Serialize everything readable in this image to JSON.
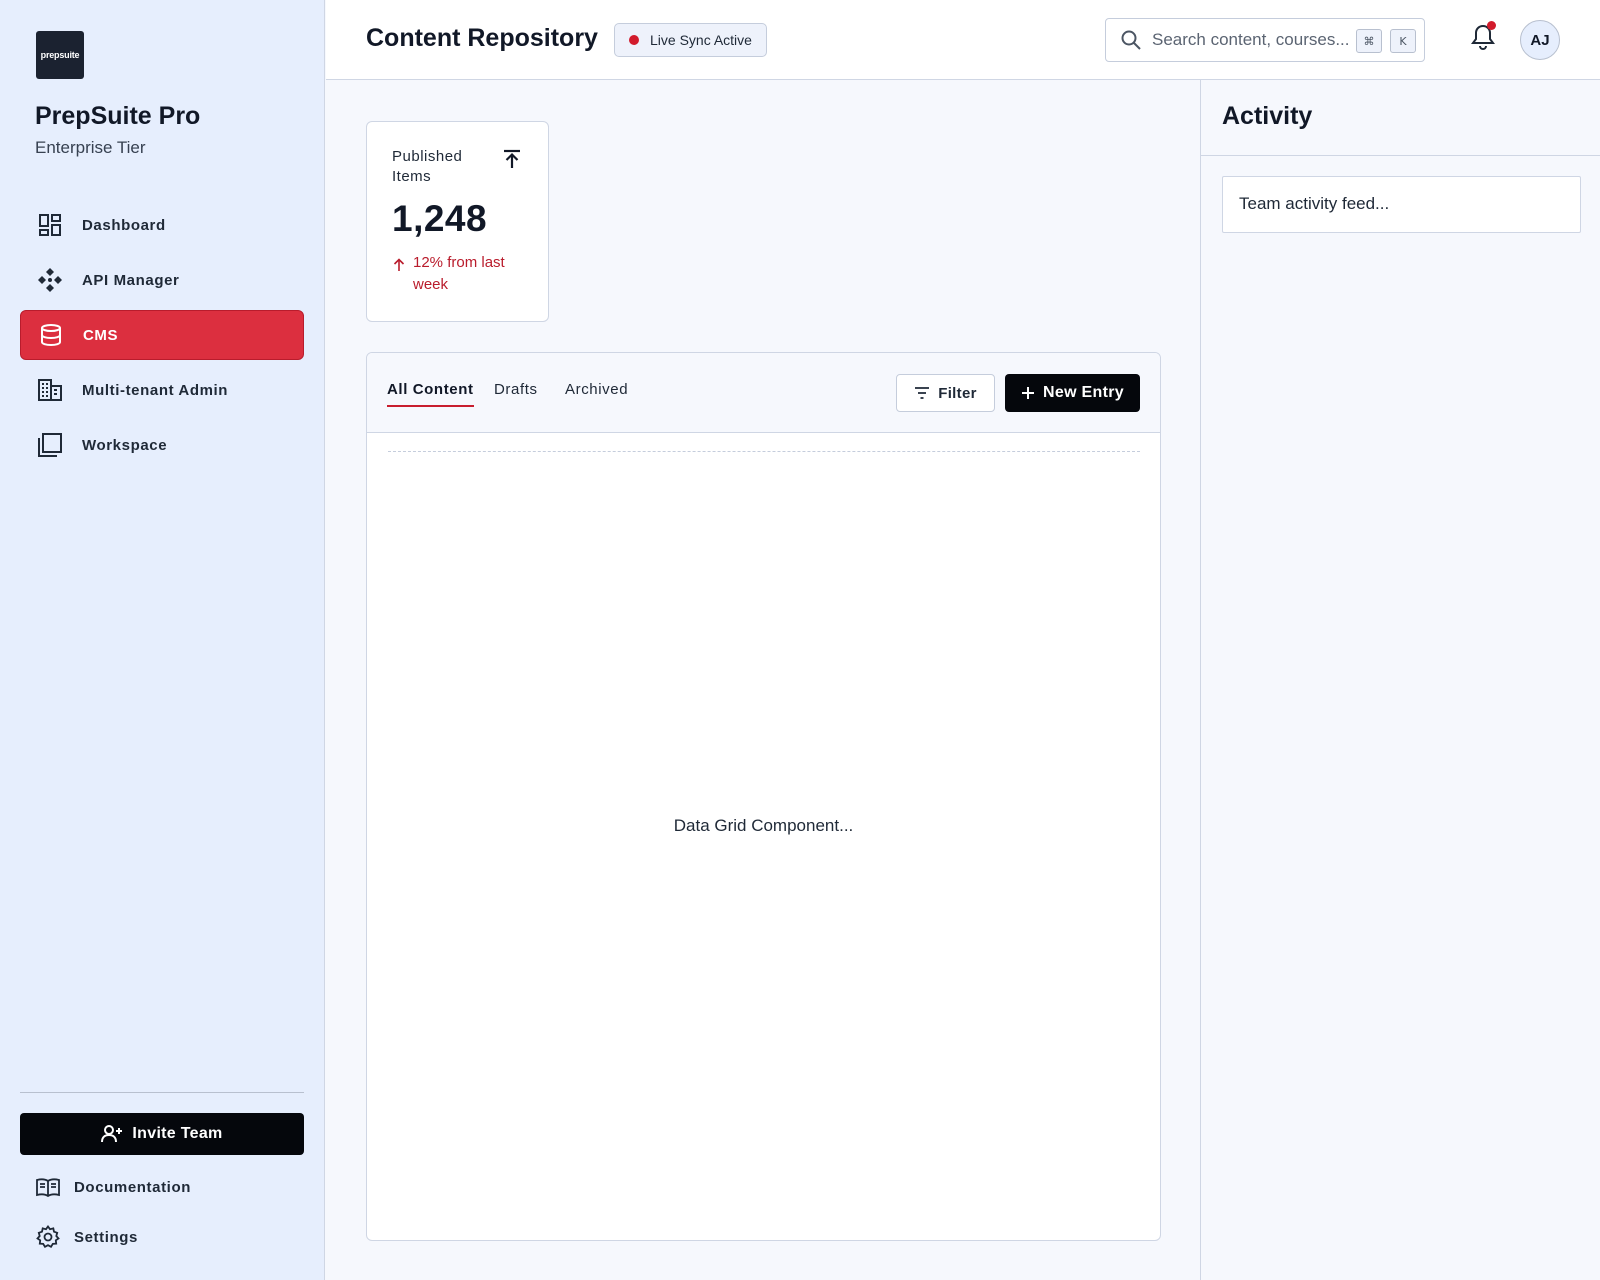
{
  "sidebar": {
    "logo_text": "prepsuite",
    "brand_name": "PrepSuite Pro",
    "brand_tier": "Enterprise Tier",
    "items": [
      {
        "label": "Dashboard",
        "icon": "dashboard-icon"
      },
      {
        "label": "API Manager",
        "icon": "api-icon"
      },
      {
        "label": "CMS",
        "icon": "database-icon",
        "active": true
      },
      {
        "label": "Multi-tenant Admin",
        "icon": "building-icon"
      },
      {
        "label": "Workspace",
        "icon": "workspace-icon"
      }
    ],
    "invite_label": "Invite Team",
    "documentation_label": "Documentation",
    "settings_label": "Settings"
  },
  "header": {
    "title": "Content Repository",
    "sync_label": "Live Sync Active",
    "search_placeholder": "Search content, courses...",
    "kbd_cmd": "⌘",
    "kbd_k": "K",
    "avatar_initials": "AJ"
  },
  "stat": {
    "label": "Published Items",
    "value": "1,248",
    "trend": "12% from last week"
  },
  "panel": {
    "tabs": [
      {
        "label": "All Content",
        "active": true
      },
      {
        "label": "Drafts"
      },
      {
        "label": "Archived"
      }
    ],
    "filter_label": "Filter",
    "new_entry_label": "New Entry",
    "grid_placeholder": "Data Grid Component..."
  },
  "activity": {
    "title": "Activity",
    "feed_placeholder": "Team activity feed..."
  },
  "colors": {
    "accent": "#dc2f3f",
    "sidebar_bg": "#e6eefd",
    "primary_button": "#05070c",
    "alert_dot": "#d21b2c"
  }
}
